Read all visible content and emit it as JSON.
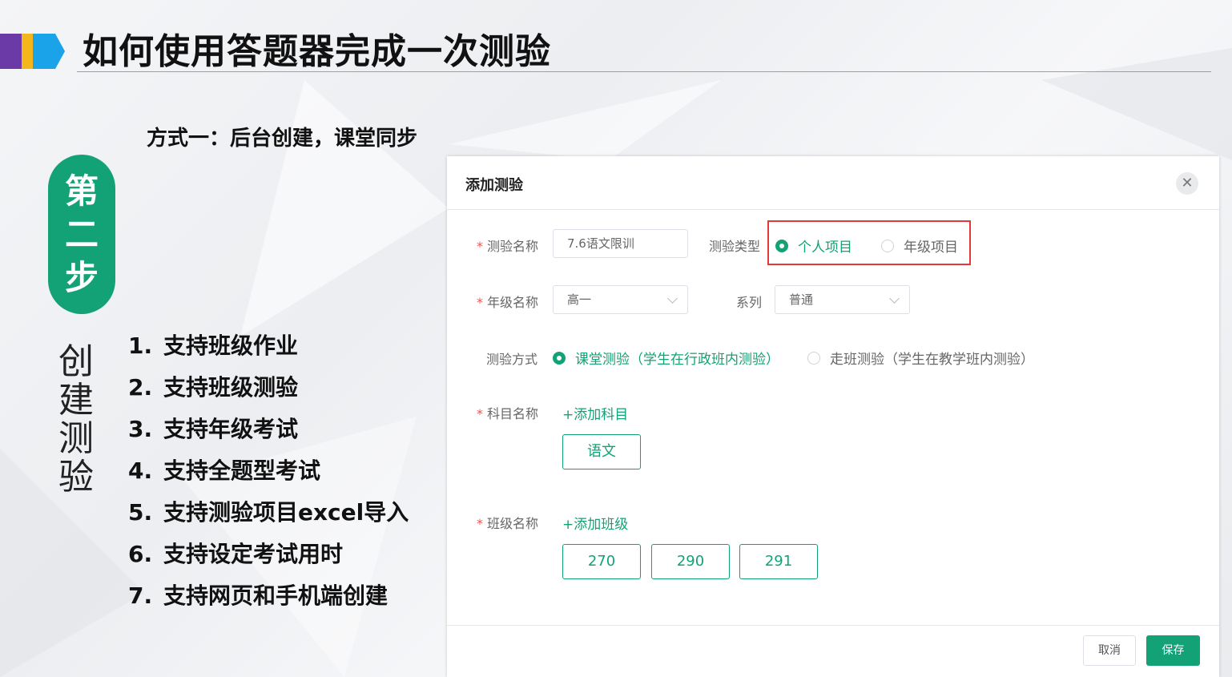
{
  "slide": {
    "title": "如何使用答题器完成一次测验",
    "subtitle": "方式一：后台创建，课堂同步",
    "step_label": [
      "第",
      "二",
      "步"
    ],
    "section_label": [
      "创",
      "建",
      "测",
      "验"
    ],
    "features": [
      {
        "num": "1.",
        "text": "支持班级作业"
      },
      {
        "num": "2.",
        "text": "支持班级测验"
      },
      {
        "num": "3.",
        "text": "支持年级考试"
      },
      {
        "num": "4.",
        "text": "支持全题型考试"
      },
      {
        "num": "5.",
        "text": "支持测验项目excel导入"
      },
      {
        "num": "6.",
        "text": "支持设定考试用时"
      },
      {
        "num": "7.",
        "text": "支持网页和手机端创建"
      }
    ],
    "accent_color": "#12a276"
  },
  "dialog": {
    "title": "添加测验",
    "close_icon": "close-icon",
    "quiz_name": {
      "label": "测验名称",
      "value": "7.6语文限训"
    },
    "quiz_type": {
      "label": "测验类型",
      "options": [
        "个人项目",
        "年级项目"
      ],
      "selected": "个人项目"
    },
    "grade": {
      "label": "年级名称",
      "value": "高一"
    },
    "series": {
      "label": "系列",
      "value": "普通"
    },
    "quiz_mode": {
      "label": "测验方式",
      "options": [
        "课堂测验（学生在行政班内测验）",
        "走班测验（学生在教学班内测验）"
      ],
      "selected": "课堂测验（学生在行政班内测验）"
    },
    "subject": {
      "label": "科目名称",
      "add_label": "+添加科目",
      "tags": [
        "语文"
      ]
    },
    "class": {
      "label": "班级名称",
      "add_label": "+添加班级",
      "tags": [
        "270",
        "290",
        "291"
      ]
    },
    "cancel_label": "取消",
    "save_label": "保存"
  }
}
